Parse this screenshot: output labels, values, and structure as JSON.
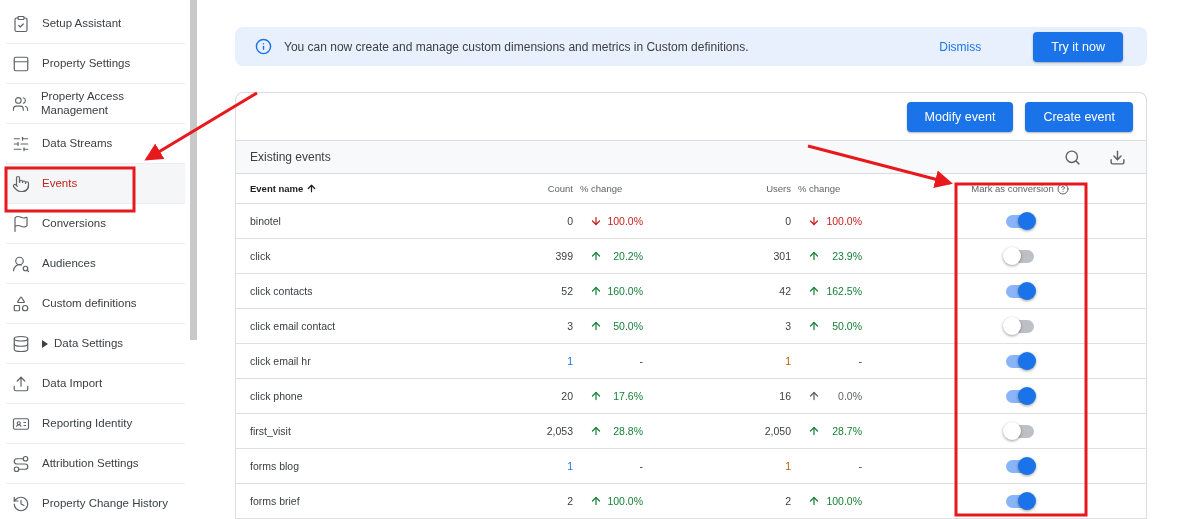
{
  "sidebar": {
    "items": [
      {
        "label": "Setup Assistant",
        "kind": "link",
        "selected": false
      },
      {
        "label": "Property Settings",
        "kind": "link",
        "selected": false
      },
      {
        "label": "Property Access Management",
        "kind": "link",
        "selected": false
      },
      {
        "label": "Data Streams",
        "kind": "link",
        "selected": false
      },
      {
        "label": "Events",
        "kind": "link",
        "selected": true
      },
      {
        "label": "Conversions",
        "kind": "link",
        "selected": false
      },
      {
        "label": "Audiences",
        "kind": "link",
        "selected": false
      },
      {
        "label": "Custom definitions",
        "kind": "link",
        "selected": false
      },
      {
        "label": "Data Settings",
        "kind": "group",
        "expanded": false,
        "selected": false
      },
      {
        "label": "Data Import",
        "kind": "link",
        "selected": false
      },
      {
        "label": "Reporting Identity",
        "kind": "link",
        "selected": false
      },
      {
        "label": "Attribution Settings",
        "kind": "link",
        "selected": false
      },
      {
        "label": "Property Change History",
        "kind": "link",
        "selected": false
      }
    ]
  },
  "banner": {
    "message": "You can now create and manage custom dimensions and metrics in Custom definitions.",
    "dismiss": "Dismiss",
    "action": "Try it now"
  },
  "events_card": {
    "buttons": [
      "Modify event",
      "Create event"
    ],
    "title": "Existing events",
    "columns": [
      {
        "label": "Event name",
        "sorted": true
      },
      {
        "label": "Count",
        "sorted": false
      },
      {
        "label": "% change",
        "sorted": false
      },
      {
        "label": "Users",
        "sorted": false
      },
      {
        "label": "% change",
        "sorted": false
      },
      {
        "label": "Mark as conversion",
        "sorted": false
      }
    ],
    "rows": [
      {
        "name": "binotel",
        "count": "0",
        "count_low_data": false,
        "count_change": {
          "kind": "down",
          "text": "100.0%"
        },
        "users": "0",
        "users_low_data": false,
        "users_change": {
          "kind": "down",
          "text": "100.0%"
        },
        "conversion": true
      },
      {
        "name": "click",
        "count": "399",
        "count_low_data": false,
        "count_change": {
          "kind": "up",
          "text": "20.2%"
        },
        "users": "301",
        "users_low_data": false,
        "users_change": {
          "kind": "up",
          "text": "23.9%"
        },
        "conversion": false
      },
      {
        "name": "click contacts",
        "count": "52",
        "count_low_data": false,
        "count_change": {
          "kind": "up",
          "text": "160.0%"
        },
        "users": "42",
        "users_low_data": false,
        "users_change": {
          "kind": "up",
          "text": "162.5%"
        },
        "conversion": true
      },
      {
        "name": "click email contact",
        "count": "3",
        "count_low_data": false,
        "count_change": {
          "kind": "up",
          "text": "50.0%"
        },
        "users": "3",
        "users_low_data": false,
        "users_change": {
          "kind": "up",
          "text": "50.0%"
        },
        "conversion": false
      },
      {
        "name": "click email hr",
        "count": "1",
        "count_low_data": true,
        "count_change": {
          "kind": "none",
          "text": "-"
        },
        "users": "1",
        "users_low_data": true,
        "users_change": {
          "kind": "none",
          "text": "-"
        },
        "conversion": true
      },
      {
        "name": "click phone",
        "count": "20",
        "count_low_data": false,
        "count_change": {
          "kind": "up",
          "text": "17.6%"
        },
        "users": "16",
        "users_low_data": false,
        "users_change": {
          "kind": "flat",
          "text": "0.0%"
        },
        "conversion": true
      },
      {
        "name": "first_visit",
        "count": "2,053",
        "count_low_data": false,
        "count_change": {
          "kind": "up",
          "text": "28.8%"
        },
        "users": "2,050",
        "users_low_data": false,
        "users_change": {
          "kind": "up",
          "text": "28.7%"
        },
        "conversion": false
      },
      {
        "name": "forms blog",
        "count": "1",
        "count_low_data": true,
        "count_change": {
          "kind": "none",
          "text": "-"
        },
        "users": "1",
        "users_low_data": true,
        "users_change": {
          "kind": "none",
          "text": "-"
        },
        "conversion": true
      },
      {
        "name": "forms brief",
        "count": "2",
        "count_low_data": false,
        "count_change": {
          "kind": "up",
          "text": "100.0%"
        },
        "users": "2",
        "users_low_data": false,
        "users_change": {
          "kind": "up",
          "text": "100.0%"
        },
        "conversion": true
      }
    ]
  }
}
